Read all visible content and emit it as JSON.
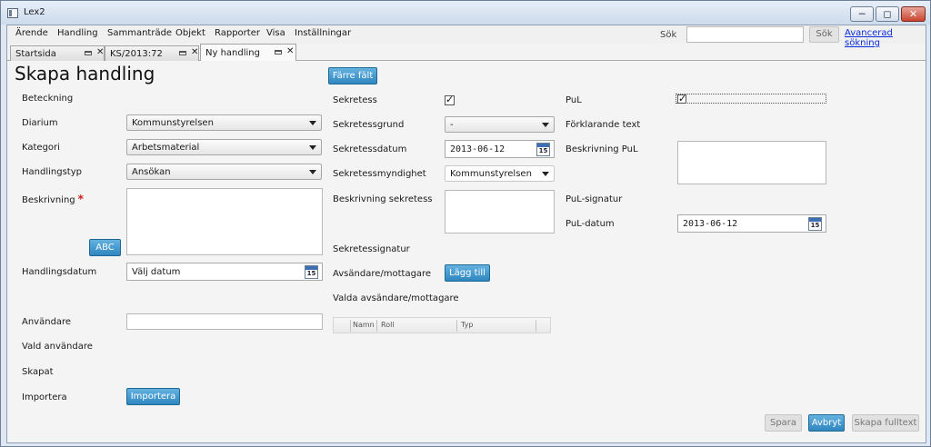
{
  "window": {
    "title": "Lex2"
  },
  "menu": [
    "Ärende",
    "Handling",
    "Sammanträde",
    "Objekt",
    "Rapporter",
    "Visa",
    "Inställningar"
  ],
  "search": {
    "label": "Sök",
    "value": "",
    "button": "Sök",
    "advanced": "Avancerad sökning"
  },
  "tabs": [
    {
      "label": "Startsida"
    },
    {
      "label": "KS/2013:72"
    },
    {
      "label": "Ny handling"
    }
  ],
  "form": {
    "title": "Skapa handling",
    "fewer_fields": "Färre fält",
    "left": {
      "beteckning": "Beteckning",
      "diarium": {
        "label": "Diarium",
        "value": "Kommunstyrelsen"
      },
      "kategori": {
        "label": "Kategori",
        "value": "Arbetsmaterial"
      },
      "handlingstyp": {
        "label": "Handlingstyp",
        "value": "Ansökan"
      },
      "beskrivning": {
        "label": "Beskrivning",
        "required": "*",
        "value": ""
      },
      "abc": "ABC",
      "handlingsdatum": {
        "label": "Handlingsdatum",
        "placeholder": "Välj datum"
      },
      "anvandare": {
        "label": "Användare",
        "value": ""
      },
      "vald_anvandare": "Vald användare",
      "skapat": "Skapat",
      "importera": {
        "label": "Importera",
        "button": "Importera"
      }
    },
    "middle": {
      "sekretess": {
        "label": "Sekretess",
        "checked": "✓"
      },
      "sekretessgrund": {
        "label": "Sekretessgrund",
        "value": "-"
      },
      "sekretessdatum": {
        "label": "Sekretessdatum",
        "value": "2013-06-12"
      },
      "sekretessmyndighet": {
        "label": "Sekretessmyndighet",
        "value": "Kommunstyrelsen"
      },
      "beskrivning_sekretess": {
        "label": "Beskrivning sekretess",
        "value": ""
      },
      "sekretessignatur": "Sekretessignatur",
      "avsandare": {
        "label": "Avsändare/mottagare",
        "button": "Lägg till"
      },
      "valda": {
        "label": "Valda avsändare/mottagare",
        "columns": [
          "Namn",
          "Roll",
          "Typ"
        ]
      }
    },
    "right": {
      "pul": {
        "label": "PuL",
        "checked": "✓"
      },
      "forklarande": "Förklarande text",
      "beskrivning_pul": {
        "label": "Beskrivning PuL",
        "value": ""
      },
      "pul_signatur": "PuL-signatur",
      "pul_datum": {
        "label": "PuL-datum",
        "value": "2013-06-12"
      }
    },
    "calendar_day": "15"
  },
  "footer": {
    "save": "Spara",
    "cancel": "Avbryt",
    "fulltext": "Skapa fulltext"
  },
  "colors": {
    "accent": "#2f86bf",
    "required": "#d01b1b",
    "link": "#0a2bd8"
  }
}
